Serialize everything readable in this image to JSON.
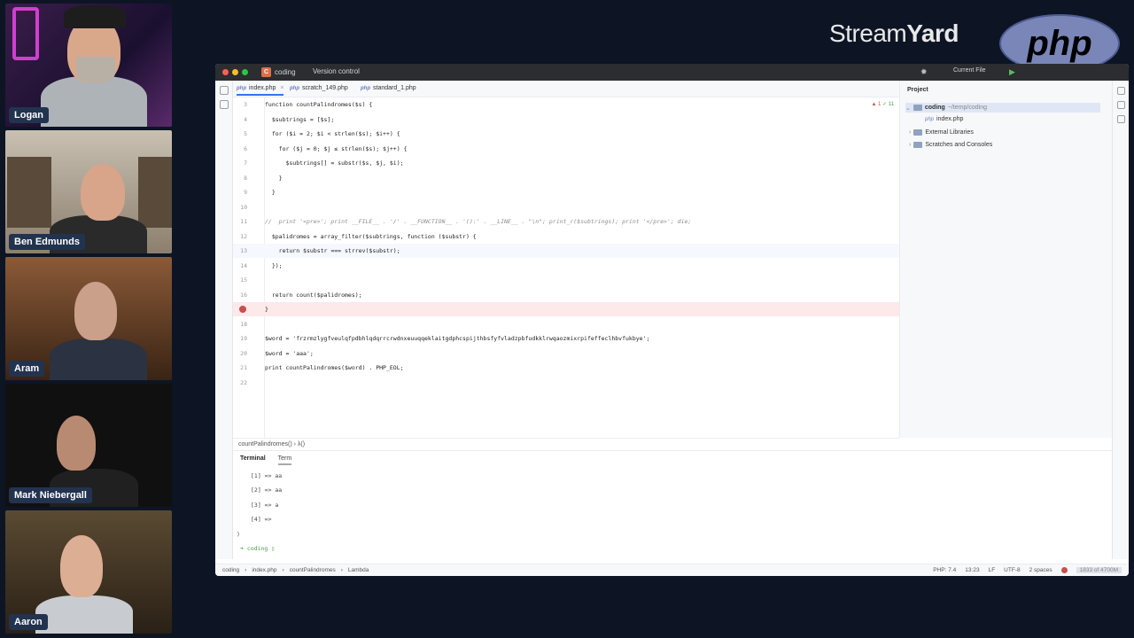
{
  "brand": {
    "stream": "Stream",
    "yard": "Yard",
    "php": "php"
  },
  "participants": [
    {
      "name": "Logan"
    },
    {
      "name": "Ben Edmunds"
    },
    {
      "name": "Aram"
    },
    {
      "name": "Mark Niebergall"
    },
    {
      "name": "Aaron"
    }
  ],
  "titlebar": {
    "project": "coding",
    "project_initial": "C",
    "version_control": "Version control",
    "current_file": "Current File"
  },
  "tabs": [
    {
      "label": "index.php",
      "icon": "php",
      "active": true
    },
    {
      "label": "scratch_149.php",
      "icon": "php",
      "active": false
    },
    {
      "label": "standard_1.php",
      "icon": "php",
      "active": false
    }
  ],
  "editor": {
    "status_errors": "1",
    "status_ok": "11",
    "lines": [
      {
        "n": "3",
        "code": "function countPalindromes($s) {"
      },
      {
        "n": "4",
        "code": "  $subtrings = [$s];"
      },
      {
        "n": "5",
        "code": "  for ($i = 2; $i < strlen($s); $i++) {"
      },
      {
        "n": "6",
        "code": "    for ($j = 0; $j ≤ strlen($s); $j++) {"
      },
      {
        "n": "7",
        "code": "      $subtrings[] = substr($s, $j, $i);"
      },
      {
        "n": "8",
        "code": "    }"
      },
      {
        "n": "9",
        "code": "  }"
      },
      {
        "n": "10",
        "code": ""
      },
      {
        "n": "11",
        "code": "//  print '<pre>'; print __FILE__ . '/' . __FUNCTION__ . '():' . __LINE__ . \"\\n\"; print_r($subtrings); print '</pre>'; die;"
      },
      {
        "n": "12",
        "code": "  $palidromes = array_filter($subtrings, function ($substr) {"
      },
      {
        "n": "13",
        "code": "    return $substr === strrev($substr);"
      },
      {
        "n": "14",
        "code": "  });"
      },
      {
        "n": "15",
        "code": ""
      },
      {
        "n": "16",
        "code": "  return count($palidromes);"
      },
      {
        "n": "",
        "code": "}"
      },
      {
        "n": "18",
        "code": ""
      },
      {
        "n": "19",
        "code": "$word = 'frzrmzlygfveulqfpdbhlqdqrrcrwdnxeuuqqeklaitgdphcspijthbsfyfvladzpbfudkklrwqaozmixrpifeffeclhbvfukbye';"
      },
      {
        "n": "20",
        "code": "$word = 'aaa';"
      },
      {
        "n": "21",
        "code": "print countPalindromes($word) . PHP_EOL;"
      },
      {
        "n": "22",
        "code": ""
      }
    ]
  },
  "breadcrumb": "countPalindromes() › λ()",
  "project_panel": {
    "header": "Project",
    "root": "coding",
    "root_path": "~/temp/coding",
    "file": "index.php",
    "ext_libs": "External Libraries",
    "scratches": "Scratches and Consoles"
  },
  "terminal": {
    "tab1": "Terminal",
    "tab2": "Term",
    "lines": [
      "[1] => aa",
      "[2] => aa",
      "[3] => a",
      "[4] =>",
      ")"
    ],
    "prompt": "coding"
  },
  "statusbar": {
    "crumbs": [
      "coding",
      "index.php",
      "countPalindromes",
      "Lambda"
    ],
    "php": "PHP: 7.4",
    "pos": "13:23",
    "lf": "LF",
    "enc": "UTF-8",
    "indent": "2 spaces",
    "mem": "1833 of 4700M"
  },
  "colors": {
    "background": "#0d1524",
    "name_tag": "#22334f",
    "php_logo": "#7a86b8",
    "parrot": "#e87ed8"
  }
}
